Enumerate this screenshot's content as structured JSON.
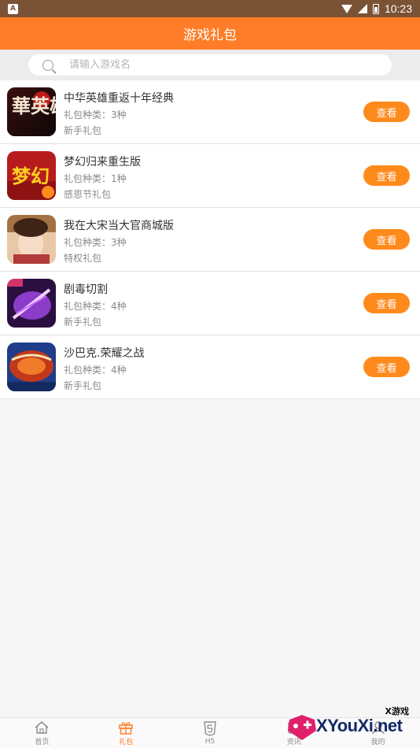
{
  "status_bar": {
    "notif_label": "A",
    "time": "10:23"
  },
  "header": {
    "title": "游戏礼包"
  },
  "search": {
    "placeholder": "请输入游戏名"
  },
  "games": [
    {
      "name": "中华英雄重返十年经典",
      "gift_types": "礼包种类：3种",
      "gift_name": "新手礼包",
      "button": "查看",
      "icon_text": "華英雄"
    },
    {
      "name": "梦幻归来重生版",
      "gift_types": "礼包种类：1种",
      "gift_name": "感恩节礼包",
      "button": "查看",
      "icon_text": "梦幻"
    },
    {
      "name": "我在大宋当大官商城版",
      "gift_types": "礼包种类：3种",
      "gift_name": "特权礼包",
      "button": "查看",
      "icon_text": ""
    },
    {
      "name": "剧毒切割",
      "gift_types": "礼包种类：4种",
      "gift_name": "新手礼包",
      "button": "查看",
      "icon_text": ""
    },
    {
      "name": "沙巴克.荣耀之战",
      "gift_types": "礼包种类：4种",
      "gift_name": "新手礼包",
      "button": "查看",
      "icon_text": ""
    }
  ],
  "tabs": [
    {
      "label": "首页",
      "icon": "home-icon",
      "active": false
    },
    {
      "label": "礼包",
      "icon": "gift-icon",
      "active": true
    },
    {
      "label": "H5",
      "icon": "html5-icon",
      "active": false
    },
    {
      "label": "资讯",
      "icon": "news-icon",
      "active": false
    },
    {
      "label": "我的",
      "icon": "profile-icon",
      "active": false
    }
  ],
  "watermark": {
    "top": "X游戏",
    "main": "XYouXi.net"
  },
  "colors": {
    "accent": "#ff7d28",
    "button": "#ff8a1c",
    "status_bar": "#7a5235"
  }
}
